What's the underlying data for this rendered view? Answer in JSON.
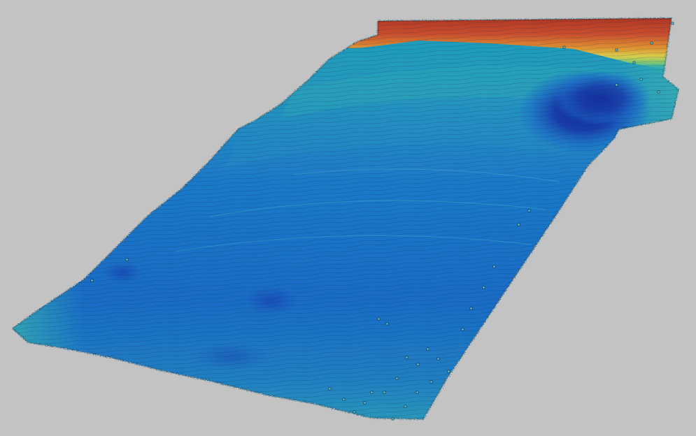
{
  "scene": {
    "background_color": "#c3c3c3",
    "colormap": [
      "#1a3fb0",
      "#1f6fd0",
      "#2a9ac8",
      "#3fb8b0",
      "#7ed07a",
      "#e8d84a",
      "#f09a2e",
      "#d8502a",
      "#b8331e"
    ],
    "surface_type": "bathymetric-surface",
    "features": [
      {
        "name": "shallow-ridge",
        "color": "#d8502a"
      },
      {
        "name": "deep-depression",
        "color": "#1a3fb0"
      }
    ]
  }
}
